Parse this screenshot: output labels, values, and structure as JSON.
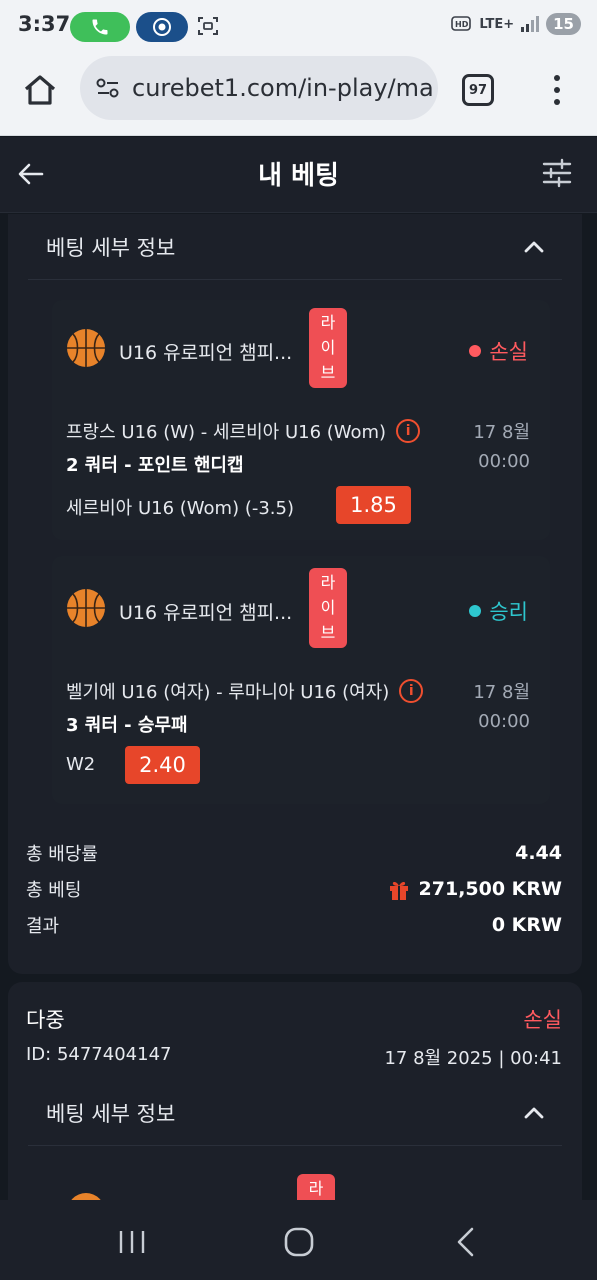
{
  "status_bar": {
    "time": "3:37",
    "network": "LTE+",
    "battery": "15"
  },
  "browser": {
    "url": "curebet1.com/in-play/ma",
    "tab_count": "97"
  },
  "header": {
    "title": "내 베팅"
  },
  "bet1": {
    "details_label": "베팅 세부 정보",
    "legs": [
      {
        "league": "U16 유로피언 챔피...",
        "live_chars": [
          "라",
          "이",
          "브"
        ],
        "status": "손실",
        "match": "프랑스 U16 (W) - 세르비아 U16 (Wom)",
        "date": "17 8월",
        "market": "2 쿼터 - 포인트 핸디캡",
        "time": "00:00",
        "pick": "세르비아 U16 (Wom) (-3.5)",
        "odds": "1.85"
      },
      {
        "league": "U16 유로피언 챔피...",
        "live_chars": [
          "라",
          "이",
          "브"
        ],
        "status": "승리",
        "match": "벨기에 U16 (여자) - 루마니아 U16 (여자)",
        "date": "17 8월",
        "market": "3 쿼터 - 승무패",
        "time": "00:00",
        "pick": "W2",
        "odds": "2.40"
      }
    ],
    "summary": {
      "total_odds_label": "총 배당률",
      "total_odds": "4.44",
      "total_stake_label": "총 베팅",
      "total_stake": "271,500 KRW",
      "result_label": "결과",
      "result": "0 KRW"
    }
  },
  "bet2": {
    "type": "다중",
    "status": "손실",
    "id": "ID: 5477404147",
    "date": "17 8월 2025 | 00:41",
    "details_label": "베팅 세부 정보",
    "live_char": "라"
  },
  "colors": {
    "loss": "#ff5a5f",
    "win": "#2ec7cf",
    "odds_bg": "#e7462a",
    "live_bg": "#ef4f54"
  }
}
